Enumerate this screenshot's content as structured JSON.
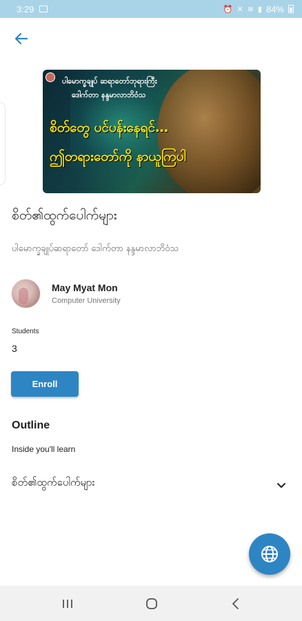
{
  "status_bar": {
    "time": "3:29",
    "battery": "84%"
  },
  "banner": {
    "line1": "ပါမောက္ခချုပ် ဆရာတော်ဘုရားကြီး",
    "line2": "ဒေါက်တာ နန္ဒမာလာဘိဝံသ",
    "headline1": "စိတ်တွေ ပင်ပန်းနေရင်…",
    "headline2": "ဤတရားတော်ကို နာယူကြပါ"
  },
  "course": {
    "title": "စိတ်၏ထွက်ပေါက်များ",
    "subtitle": "ပါမောက္ခချုပ်ဆရာတော် ဒေါက်တာ နန္ဒမာလာဘိဝံသ"
  },
  "instructor": {
    "name": "May Myat Mon",
    "organization": "Computer University"
  },
  "students": {
    "label": "Students",
    "count": "3"
  },
  "enroll_label": "Enroll",
  "outline": {
    "heading": "Outline",
    "subheading": "Inside you'll learn",
    "sections": [
      {
        "title": "စိတ်၏ထွက်ပေါက်များ"
      }
    ]
  },
  "icons": {
    "back": "arrow-left-icon",
    "chevron": "chevron-down-icon",
    "fab": "globe-icon",
    "nav": [
      "recents-icon",
      "home-icon",
      "back-icon"
    ]
  },
  "colors": {
    "accent": "#2e85c3",
    "status_bar": "#a9d4e8"
  }
}
